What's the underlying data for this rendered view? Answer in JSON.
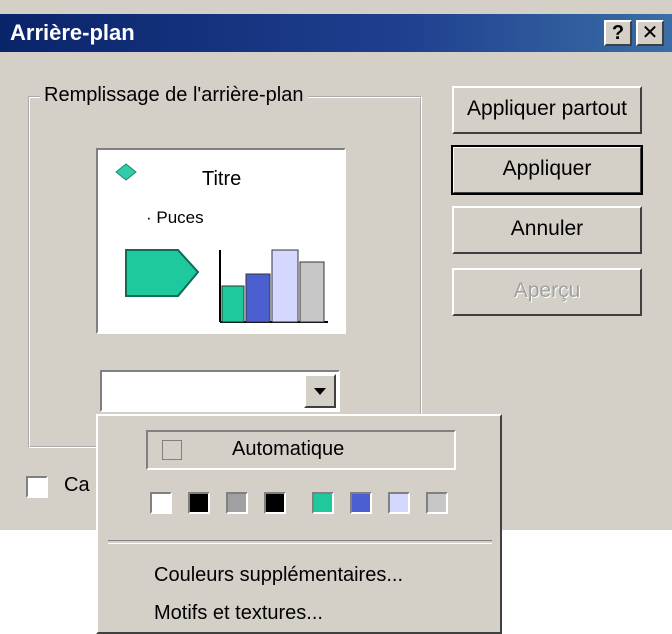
{
  "window": {
    "title": "Arrière-plan",
    "help_label": "?",
    "close_label": "✕"
  },
  "group": {
    "label": "Remplissage de l'arrière-plan"
  },
  "preview": {
    "title": "Titre",
    "bullet": "· Puces",
    "colors": {
      "diamond": "#33ccaa",
      "arrow": "#1fc99e",
      "bar1": "#1fc99e",
      "bar2": "#4b5fd1",
      "bar3": "#d4d8ff",
      "bar4": "#c7c7c7"
    }
  },
  "buttons": {
    "apply_all": "Appliquer partout",
    "apply": "Appliquer",
    "cancel": "Annuler",
    "preview": "Aperçu"
  },
  "checkbox": {
    "label": "Ca"
  },
  "dropdown": {
    "automatic": "Automatique",
    "swatches": [
      "#ffffff",
      "#000000",
      "#a0a0a0",
      "#000000",
      "#1fc99e",
      "#4b5fd1",
      "#d4d8ff",
      "#c7c7c7"
    ],
    "more_colors": "Couleurs supplémentaires...",
    "patterns": "Motifs et textures..."
  }
}
